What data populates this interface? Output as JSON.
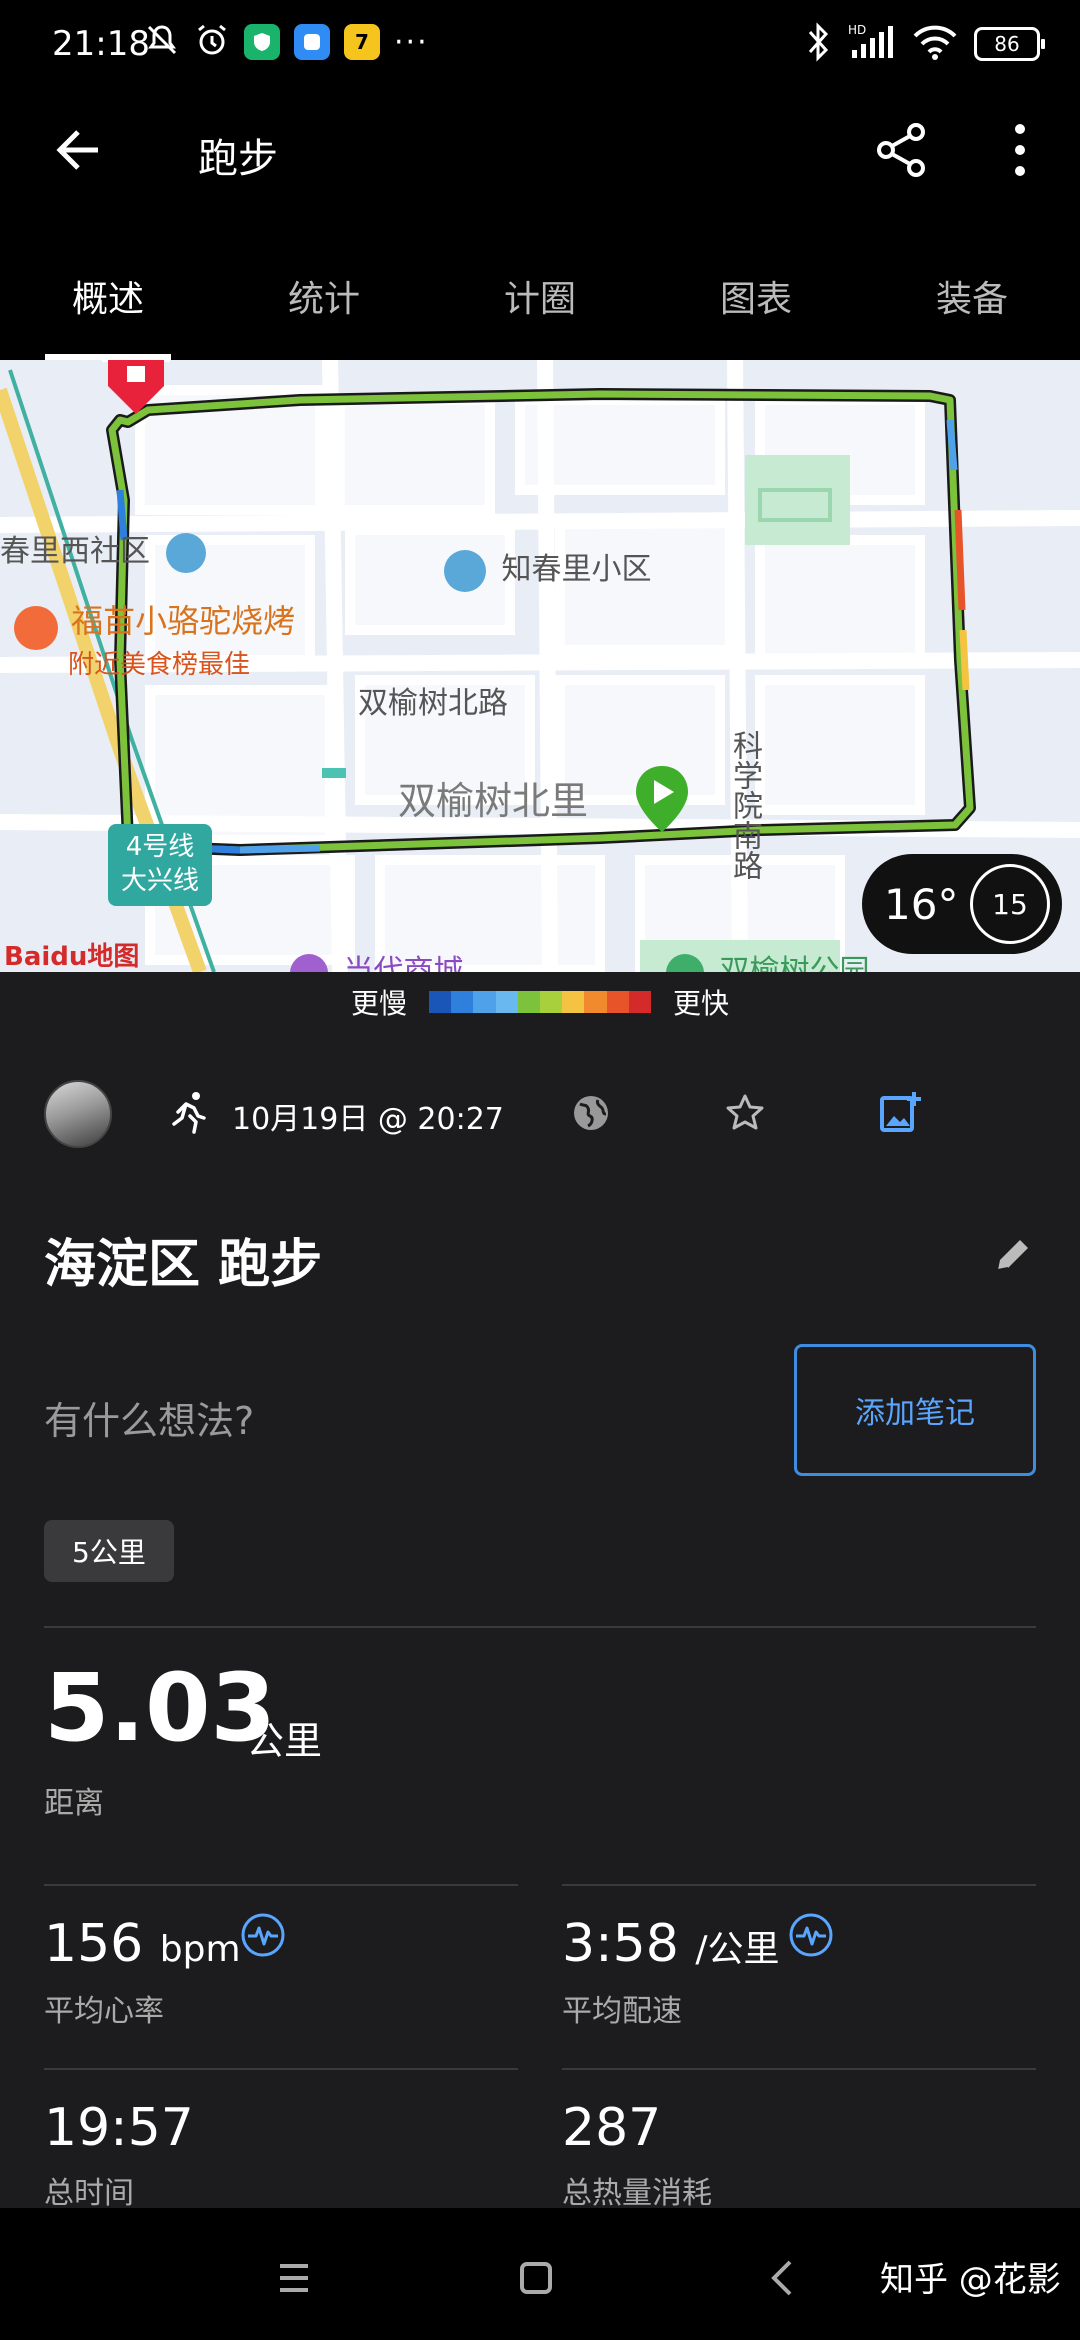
{
  "status_bar": {
    "time": "21:18",
    "battery": "86"
  },
  "app_bar": {
    "title": "跑步"
  },
  "tabs": [
    {
      "label": "概述",
      "active": true
    },
    {
      "label": "统计",
      "active": false
    },
    {
      "label": "计圈",
      "active": false
    },
    {
      "label": "图表",
      "active": false
    },
    {
      "label": "装备",
      "active": false
    }
  ],
  "map": {
    "labels": {
      "chunli_west": "春里西社区",
      "zhichunli": "知春里小区",
      "restaurant": "福苗小骆驼烧烤",
      "restaurant_sub": "附近美食榜最佳",
      "shuangyushu_road": "双榆树北路",
      "shuangyushu_north": "双榆树北里",
      "kexueyuan_road": "科学院南路",
      "subway": "4号线",
      "subway_sub": "大兴线",
      "baidu": "Baidu地图",
      "mall": "当代商城",
      "park": "双榆树公园"
    },
    "weather": {
      "temperature": "16°",
      "dial": "15"
    }
  },
  "legend": {
    "slow_label": "更慢",
    "fast_label": "更快",
    "colors": [
      "#1a56b8",
      "#2f7fdc",
      "#4fa2ea",
      "#6ab8f0",
      "#7cc23a",
      "#a8cf3c",
      "#f5c342",
      "#f08a2c",
      "#e8542a",
      "#d42a2a"
    ]
  },
  "activity": {
    "date": "10月19日 @ 20:27",
    "title": "海淀区 跑步",
    "notes_prompt": "有什么想法?",
    "add_note_label": "添加笔记",
    "tag": "5公里"
  },
  "stats": {
    "distance": {
      "value": "5.03",
      "unit": "公里",
      "label": "距离"
    },
    "heart_rate": {
      "value": "156",
      "unit": "bpm",
      "label": "平均心率"
    },
    "pace": {
      "value": "3:58",
      "unit": "/公里",
      "label": "平均配速"
    },
    "total_time": {
      "value": "19:57",
      "label": "总时间"
    },
    "calories": {
      "value": "287",
      "label": "总热量消耗"
    }
  },
  "watermark": "知乎 @花影",
  "colors": {
    "accent_blue": "#5aa6ff",
    "route_green": "#7cc23a",
    "start_green": "#3fae2a",
    "end_red": "#e8223a"
  }
}
